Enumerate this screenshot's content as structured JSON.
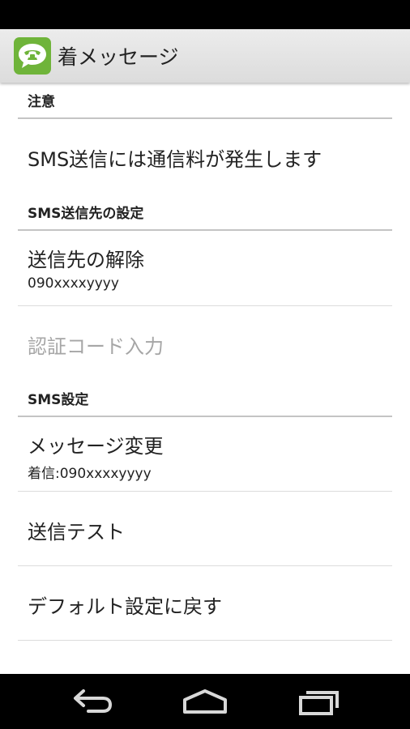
{
  "app": {
    "title": "着メッセージ",
    "icon": "phone-chat-icon",
    "accent": "#6fb43a"
  },
  "sections": {
    "notice": {
      "header": "注意",
      "items": [
        {
          "title": "SMS送信には通信料が発生します"
        }
      ]
    },
    "destination": {
      "header": "SMS送信先の設定",
      "items": [
        {
          "title": "送信先の解除",
          "summary": "090xxxxyyyy"
        },
        {
          "title": "認証コード入力",
          "disabled": true
        }
      ]
    },
    "sms": {
      "header": "SMS設定",
      "items": [
        {
          "title": "メッセージ変更",
          "summary": "着信:090xxxxyyyy"
        },
        {
          "title": "送信テスト"
        },
        {
          "title": "デフォルト設定に戻す"
        }
      ]
    }
  },
  "nav": {
    "back": "back-icon",
    "home": "home-icon",
    "recents": "recents-icon"
  }
}
